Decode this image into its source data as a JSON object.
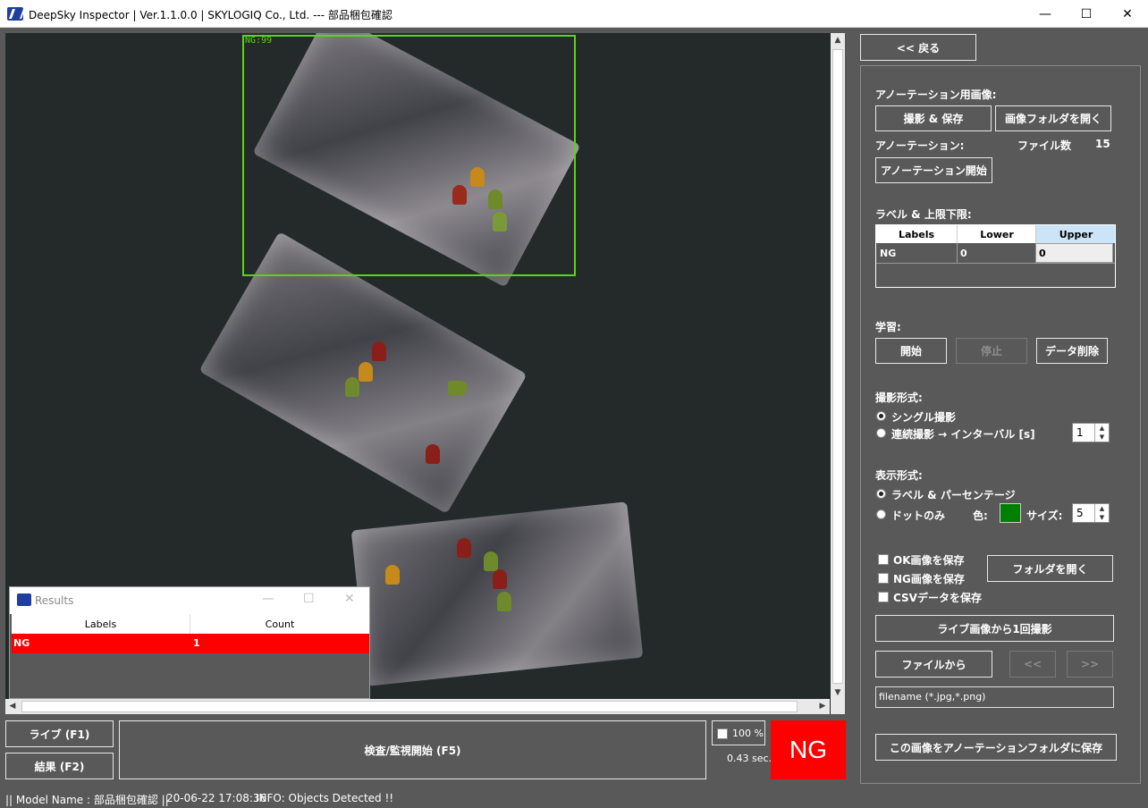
{
  "window": {
    "title": "DeepSky Inspector | Ver.1.1.0.0 | SKYLOGIQ Co., Ltd. --- 部品梱包確認",
    "minimize": "—",
    "maximize": "☐",
    "close": "✕"
  },
  "viewer": {
    "detection_label": "NG:99"
  },
  "results_window": {
    "title": "Results",
    "columns": [
      "Labels",
      "Count"
    ],
    "rows": [
      {
        "label": "NG",
        "count": "1"
      }
    ]
  },
  "bottom": {
    "live_button": "ライブ (F1)",
    "result_button": "結果 (F2)",
    "inspect_button": "検査/監視開始 (F5)",
    "zoom_checkbox": "100 %",
    "elapsed": "0.43 sec.",
    "verdict": "NG"
  },
  "status_bar": {
    "model": "|| Model Name : 部品梱包確認 ||",
    "timestamp": "20-06-22 17:08:36",
    "info": "INFO:   Objects Detected !!"
  },
  "right_panel": {
    "back_button": "<< 戻る",
    "annotation_images_label": "アノーテーション用画像:",
    "capture_save_button": "撮影 & 保存",
    "open_image_folder_button": "画像フォルダを開く",
    "annotation_label": "アノーテーション:",
    "file_count_label": "ファイル数",
    "file_count_value": "15",
    "start_annotation_button": "アノーテーション開始",
    "label_limits_title": "ラベル & 上限下限:",
    "limits_table": {
      "headers": [
        "Labels",
        "Lower",
        "Upper"
      ],
      "rows": [
        {
          "label": "NG",
          "lower": "0",
          "upper": "0"
        }
      ]
    },
    "learning_label": "学習:",
    "learn_start_button": "開始",
    "learn_stop_button": "停止",
    "delete_data_button": "データ削除",
    "capture_mode_label": "撮影形式:",
    "single_capture": "シングル撮影",
    "continuous_capture": "連続撮影 → インターバル [s]",
    "interval_value": "1",
    "display_mode_label": "表示形式:",
    "label_percentage": "ラベル & パーセンテージ",
    "dots_only": "ドットのみ",
    "color_label": "色:",
    "dot_color": "#008000",
    "size_label": "サイズ:",
    "size_value": "5",
    "save_ok_images": "OK画像を保存",
    "save_ng_images": "NG画像を保存",
    "save_csv": "CSVデータを保存",
    "open_folder_button": "フォルダを開く",
    "capture_from_live_button": "ライブ画像から1回撮影",
    "from_file_button": "ファイルから",
    "prev_button": "<<",
    "next_button": ">>",
    "filename_placeholder": "filename (*.jpg,*.png)",
    "save_to_annotation_button": "この画像をアノーテーションフォルダに保存"
  },
  "colors": {
    "background": "#595959",
    "ng_red": "#ff0000",
    "detection_green": "#5cd40f"
  }
}
